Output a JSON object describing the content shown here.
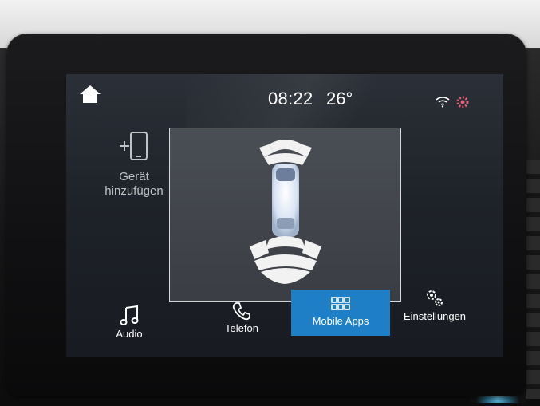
{
  "status": {
    "time": "08:22",
    "temperature": "26°"
  },
  "sidebar": {
    "add_device_label_1": "Gerät",
    "add_device_label_2": "hinzufügen"
  },
  "nav": {
    "audio": "Audio",
    "phone": "Telefon",
    "mobile_apps": "Mobile Apps",
    "settings": "Einstellungen",
    "active_tab": "Mobile Apps"
  },
  "colors": {
    "accent": "#1e7fc6",
    "text": "#ffffff",
    "screen_bg": "#1e2229"
  },
  "icons": [
    "home-icon",
    "wifi-icon",
    "gear-badge-icon",
    "add-device-icon",
    "music-note-icon",
    "phone-icon",
    "grid-icon",
    "gears-icon"
  ]
}
